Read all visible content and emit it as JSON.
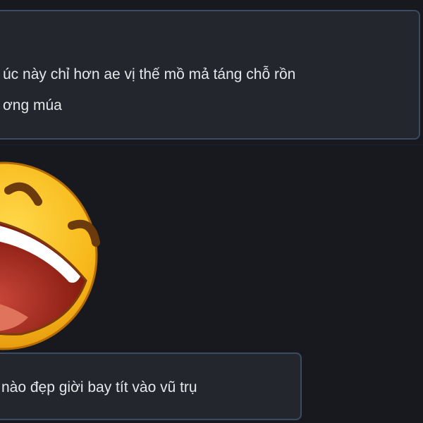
{
  "messages": [
    {
      "lines": [
        "úc này chỉ hơn ae vị thế mồ mả táng chỗ rồn",
        "ơng múa"
      ]
    },
    {
      "sticker": "laughing-emoji-icon"
    },
    {
      "lines": [
        "nào đẹp giời bay tít vào vũ trụ"
      ]
    }
  ],
  "colors": {
    "background": "#17191f",
    "bubble": "#23262d",
    "bubble_border": "#3a4b62",
    "text": "#e6e7ea",
    "emoji_face": "#f7b819",
    "emoji_mouth": "#8a1e12"
  }
}
